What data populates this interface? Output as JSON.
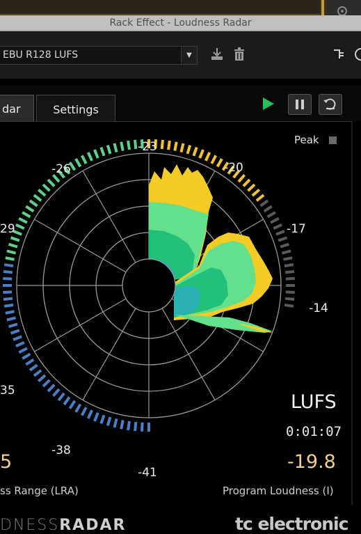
{
  "window": {
    "title": "Rack Effect - Loudness Radar",
    "preset": "EBU R128 LUFS"
  },
  "tabs": [
    {
      "label": "dar",
      "active": true
    },
    {
      "label": "Settings",
      "active": false
    }
  ],
  "transport": {
    "play_icon": "play-icon",
    "pause_icon": "pause-icon",
    "reset_icon": "reset-icon"
  },
  "radar": {
    "peak_label": "Peak",
    "scale_labels": [
      {
        "text": "-23",
        "lufs": -23
      },
      {
        "text": "-20",
        "lufs": -20
      },
      {
        "text": "-17",
        "lufs": -17
      },
      {
        "text": "-14",
        "lufs": -14
      },
      {
        "text": "-26",
        "lufs": -26
      },
      {
        "text": "29",
        "lufs": -29
      },
      {
        "text": "35",
        "lufs": -35
      },
      {
        "text": "-38",
        "lufs": -38
      },
      {
        "text": "-41",
        "lufs": -41
      }
    ],
    "colors": {
      "blue": "#4a7fc5",
      "green": "#5fd08a",
      "yellow": "#f2c230",
      "gray": "#5a5a5a",
      "cyan_fill": "#29b0b0",
      "dark_green_fill": "#22c07a",
      "light_green_fill": "#63e08c",
      "yellow_fill": "#f5cc26"
    }
  },
  "readouts": {
    "unit": "LUFS",
    "time": "0:01:07",
    "program_value": "-19.8",
    "program_label": "Program Loudness (I)",
    "lra_value": "5",
    "lra_label": "ss Range (LRA)"
  },
  "footer": {
    "brand_left_thin": "DNESS",
    "brand_left_bold": "RADAR",
    "brand_right": "tc electronic"
  }
}
